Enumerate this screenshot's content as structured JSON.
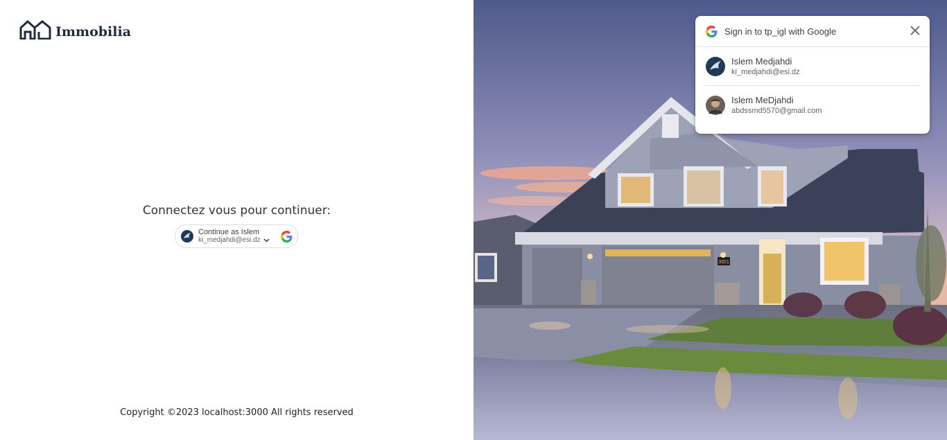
{
  "brand": {
    "name": "Immobilia",
    "icon": "house-logo-icon"
  },
  "login": {
    "prompt": "Connectez vous pour continuer:",
    "google_button": {
      "label": "Continue as Islem",
      "email": "ki_medjahdi@esi.dz",
      "icons": [
        "avatar",
        "chevron-down-icon",
        "google-g-icon"
      ]
    }
  },
  "footer": {
    "copyright": "Copyright ©2023 localhost:3000 All rights reserved"
  },
  "hero": {
    "image": "suburban-house-photo",
    "house_number": "3321"
  },
  "google_popup": {
    "title": "Sign in to tp_igl with Google",
    "accounts": [
      {
        "name": "Islem Medjahdi",
        "email": "ki_medjahdi@esi.dz"
      },
      {
        "name": "Islem MeDjahdi",
        "email": "abdssmd5570@gmail.com"
      }
    ]
  },
  "colors": {
    "brand": "#1f2b3d",
    "google_blue": "#4285F4",
    "google_red": "#EA4335",
    "google_yellow": "#FBBC05",
    "google_green": "#34A853"
  }
}
